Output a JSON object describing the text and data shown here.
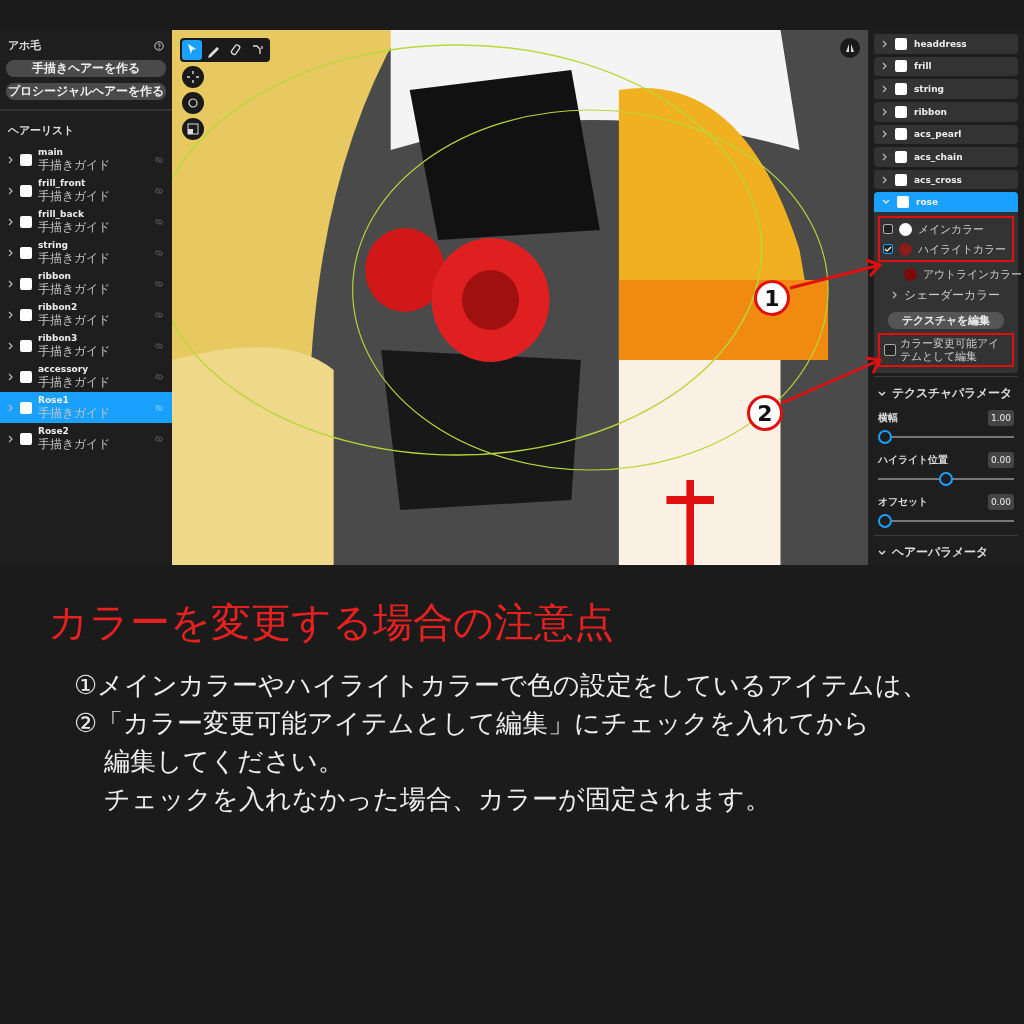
{
  "left_panel": {
    "title": "アホ毛",
    "buttons": [
      "手描きヘアーを作る",
      "プロシージャルヘアーを作る"
    ],
    "list_title": "ヘアーリスト",
    "items": [
      {
        "name": "main",
        "sub": "手描きガイド",
        "selected": false
      },
      {
        "name": "frill_front",
        "sub": "手描きガイド",
        "selected": false
      },
      {
        "name": "frill_back",
        "sub": "手描きガイド",
        "selected": false
      },
      {
        "name": "string",
        "sub": "手描きガイド",
        "selected": false
      },
      {
        "name": "ribbon",
        "sub": "手描きガイド",
        "selected": false
      },
      {
        "name": "ribbon2",
        "sub": "手描きガイド",
        "selected": false
      },
      {
        "name": "ribbon3",
        "sub": "手描きガイド",
        "selected": false
      },
      {
        "name": "accessory",
        "sub": "手描きガイド",
        "selected": false
      },
      {
        "name": "Rose1",
        "sub": "手描きガイド",
        "selected": true
      },
      {
        "name": "Rose2",
        "sub": "手描きガイド",
        "selected": false
      }
    ]
  },
  "viewport": {
    "kind": "picture",
    "tools": [
      {
        "selected": true
      },
      {
        "selected": false
      },
      {
        "selected": false
      },
      {
        "selected": false
      }
    ]
  },
  "right_panel": {
    "materials": [
      {
        "name": "headdress",
        "expanded": false
      },
      {
        "name": "frill",
        "expanded": false
      },
      {
        "name": "string",
        "expanded": false
      },
      {
        "name": "ribbon",
        "expanded": false
      },
      {
        "name": "acs_pearl",
        "expanded": false
      },
      {
        "name": "acs_chain",
        "expanded": false
      },
      {
        "name": "acs_cross",
        "expanded": false
      },
      {
        "name": "rose",
        "expanded": true
      }
    ],
    "colors": [
      {
        "label": "メインカラー",
        "kind": "checkbox",
        "checked": false,
        "color": "#ffffff"
      },
      {
        "label": "ハイライトカラー",
        "kind": "checkbox",
        "checked": true,
        "color": "#8a1c1c"
      },
      {
        "label": "アウトラインカラー",
        "kind": "plain",
        "color": "#7a0a0a"
      }
    ],
    "shader": "シェーダーカラー",
    "texture_button": "テクスチャを編集",
    "editable": {
      "label": "カラー変更可能アイテムとして編集",
      "checked": false
    },
    "texture_params": {
      "title": "テクスチャパラメータ",
      "sliders": [
        {
          "label": "横幅",
          "value": "1.00",
          "level": 0
        },
        {
          "label": "ハイライト位置",
          "value": "0.00",
          "level": 0.5
        },
        {
          "label": "オフセット",
          "value": "0.00",
          "level": 0
        }
      ]
    },
    "hair_params": {
      "title": "ヘアーパラメータ"
    }
  },
  "callouts": [
    "1",
    "2"
  ],
  "caption": {
    "title": "カラーを変更する場合の注意点",
    "lines": [
      "①メインカラーやハイライトカラーで色の設定をしているアイテムは、",
      "②「カラー変更可能アイテムとして編集」にチェックを入れてから",
      "編集してください。",
      "チェックを入れなかった場合、カラーが固定されます。"
    ]
  }
}
